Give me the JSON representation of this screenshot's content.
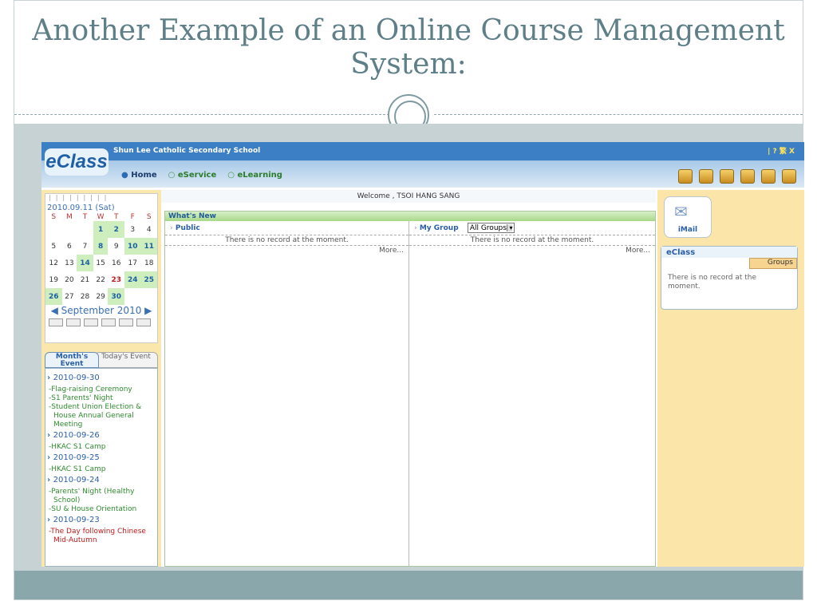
{
  "slide": {
    "title": "Another Example of an Online Course Management System:"
  },
  "app": {
    "logo": "eClass",
    "school_name": "Shun Lee Catholic Secondary School",
    "top_links": "| ?  繁  X",
    "nav": {
      "home": "Home",
      "eservice": "eService",
      "elearning": "eLearning"
    }
  },
  "welcome": "Welcome , TSOI HANG SANG",
  "calendar": {
    "current_date": "2010.09.11 (Sat)",
    "weekdays": [
      "S",
      "M",
      "T",
      "W",
      "T",
      "F",
      "S"
    ],
    "weeks": [
      [
        "",
        "",
        "",
        "1",
        "2",
        "3",
        "4"
      ],
      [
        "5",
        "6",
        "7",
        "8",
        "9",
        "10",
        "11"
      ],
      [
        "12",
        "13",
        "14",
        "15",
        "16",
        "17",
        "18"
      ],
      [
        "19",
        "20",
        "21",
        "22",
        "23",
        "24",
        "25"
      ],
      [
        "26",
        "27",
        "28",
        "29",
        "30",
        "",
        ""
      ]
    ],
    "month_label": "September 2010"
  },
  "events_tabs": {
    "month": "Month's Event",
    "today": "Today's Event"
  },
  "events": [
    {
      "date": "2010-09-30",
      "items": [
        "-Flag-raising Ceremony",
        "-S1 Parents' Night",
        "-Student Union Election & House Annual General Meeting"
      ]
    },
    {
      "date": "2010-09-26",
      "items": [
        "-HKAC S1 Camp"
      ]
    },
    {
      "date": "2010-09-25",
      "items": [
        "-HKAC S1 Camp"
      ]
    },
    {
      "date": "2010-09-24",
      "items": [
        "-Parents' Night (Healthy School)",
        "-SU & House Orientation"
      ]
    },
    {
      "date": "2010-09-23",
      "items": [
        "-The Day following Chinese Mid-Autumn"
      ]
    }
  ],
  "whats_new": {
    "title": "What's New",
    "public": {
      "label": "Public",
      "message": "There is no record at the moment.",
      "more": "More..."
    },
    "my_group": {
      "label": "My Group",
      "select_value": "All Groups",
      "message": "There is no record at the moment.",
      "more": "More..."
    }
  },
  "right_panel": {
    "imail_label": "iMail",
    "eclass_title": "eClass",
    "groups_tab": "Groups",
    "eclass_message": "There is no record at the moment."
  }
}
